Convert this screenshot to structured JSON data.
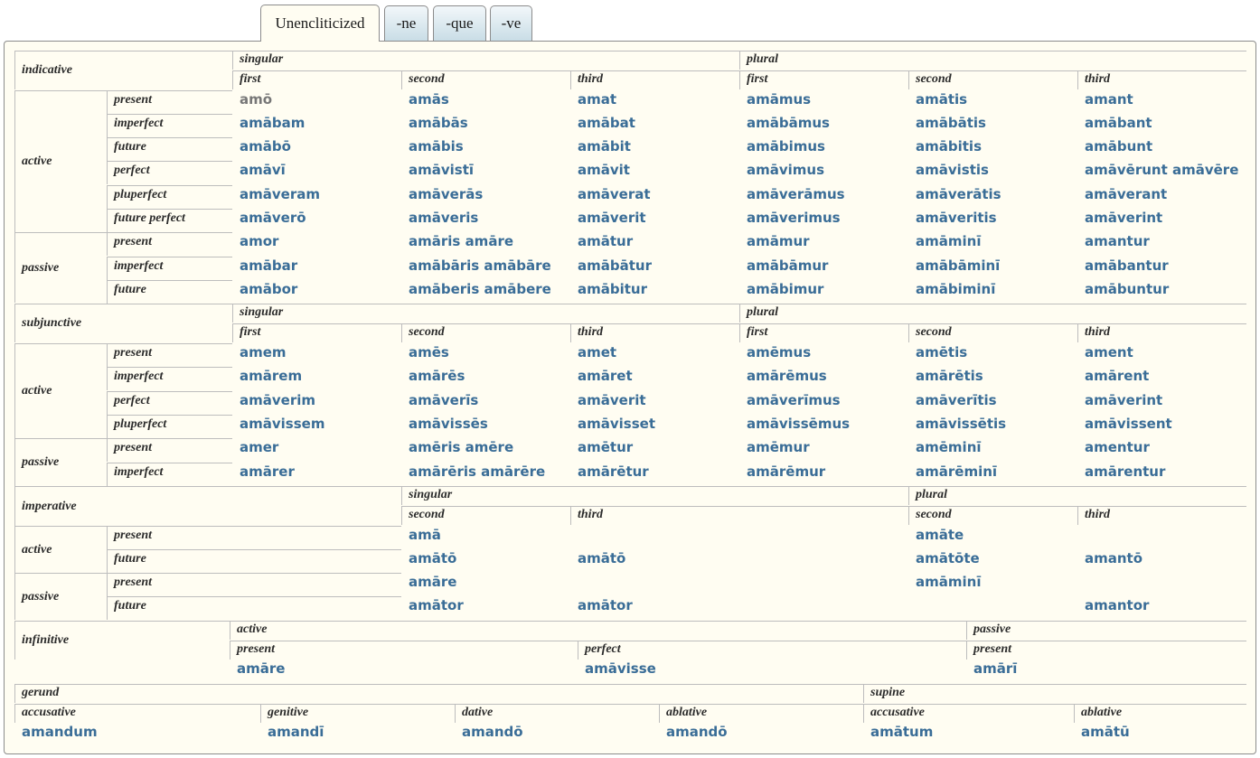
{
  "tabs": [
    "Unencliticized",
    "-ne",
    "-que",
    "-ve"
  ],
  "active_tab": "Unencliticized",
  "colors": {
    "link": "#3a6d97",
    "unlinked": "#777777",
    "panel_bg": "#fffdf2",
    "border": "#bdbdbd"
  },
  "labels": {
    "indicative": "indicative",
    "subjunctive": "subjunctive",
    "imperative": "imperative",
    "infinitive": "infinitive",
    "gerund": "gerund",
    "supine": "supine",
    "active": "active",
    "passive": "passive",
    "singular": "singular",
    "plural": "plural",
    "first": "first",
    "second": "second",
    "third": "third",
    "present": "present",
    "imperfect": "imperfect",
    "future": "future",
    "perfect": "perfect",
    "pluperfect": "pluperfect",
    "future_perfect": "future perfect",
    "accusative": "accusative",
    "genitive": "genitive",
    "dative": "dative",
    "ablative": "ablative"
  },
  "indicative": {
    "active": {
      "present": [
        "amō",
        "amās",
        "amat",
        "amāmus",
        "amātis",
        "amant"
      ],
      "imperfect": [
        "amābam",
        "amābās",
        "amābat",
        "amābāmus",
        "amābātis",
        "amābant"
      ],
      "future": [
        "amābō",
        "amābis",
        "amābit",
        "amābimus",
        "amābitis",
        "amābunt"
      ],
      "perfect": [
        "amāvī",
        "amāvistī",
        "amāvit",
        "amāvimus",
        "amāvistis",
        "amāvērunt amāvēre"
      ],
      "pluperfect": [
        "amāveram",
        "amāverās",
        "amāverat",
        "amāverāmus",
        "amāverātis",
        "amāverant"
      ],
      "future_perfect": [
        "amāverō",
        "amāveris",
        "amāverit",
        "amāverimus",
        "amāveritis",
        "amāverint"
      ]
    },
    "passive": {
      "present": [
        "amor",
        "amāris amāre",
        "amātur",
        "amāmur",
        "amāminī",
        "amantur"
      ],
      "imperfect": [
        "amābar",
        "amābāris amābāre",
        "amābātur",
        "amābāmur",
        "amābāminī",
        "amābantur"
      ],
      "future": [
        "amābor",
        "amāberis amābere",
        "amābitur",
        "amābimur",
        "amābiminī",
        "amābuntur"
      ]
    }
  },
  "subjunctive": {
    "active": {
      "present": [
        "amem",
        "amēs",
        "amet",
        "amēmus",
        "amētis",
        "ament"
      ],
      "imperfect": [
        "amārem",
        "amārēs",
        "amāret",
        "amārēmus",
        "amārētis",
        "amārent"
      ],
      "perfect": [
        "amāverim",
        "amāverīs",
        "amāverit",
        "amāverīmus",
        "amāverītis",
        "amāverint"
      ],
      "pluperfect": [
        "amāvissem",
        "amāvissēs",
        "amāvisset",
        "amāvissēmus",
        "amāvissētis",
        "amāvissent"
      ]
    },
    "passive": {
      "present": [
        "amer",
        "amēris amēre",
        "amētur",
        "amēmur",
        "amēminī",
        "amentur"
      ],
      "imperfect": [
        "amārer",
        "amārēris amārēre",
        "amārētur",
        "amārēmur",
        "amārēminī",
        "amārentur"
      ]
    }
  },
  "imperative": {
    "active": {
      "present": [
        "amā",
        "",
        "amāte",
        ""
      ],
      "future": [
        "amātō",
        "amātō",
        "amātōte",
        "amantō"
      ]
    },
    "passive": {
      "present": [
        "amāre",
        "",
        "amāminī",
        ""
      ],
      "future": [
        "amātor",
        "amātor",
        "",
        "amantor"
      ]
    }
  },
  "infinitive": {
    "active_present": "amāre",
    "active_perfect": "amāvisse",
    "passive_present": "amārī"
  },
  "gerund": [
    "amandum",
    "amandī",
    "amandō",
    "amandō"
  ],
  "supine": [
    "amātum",
    "amātū"
  ]
}
